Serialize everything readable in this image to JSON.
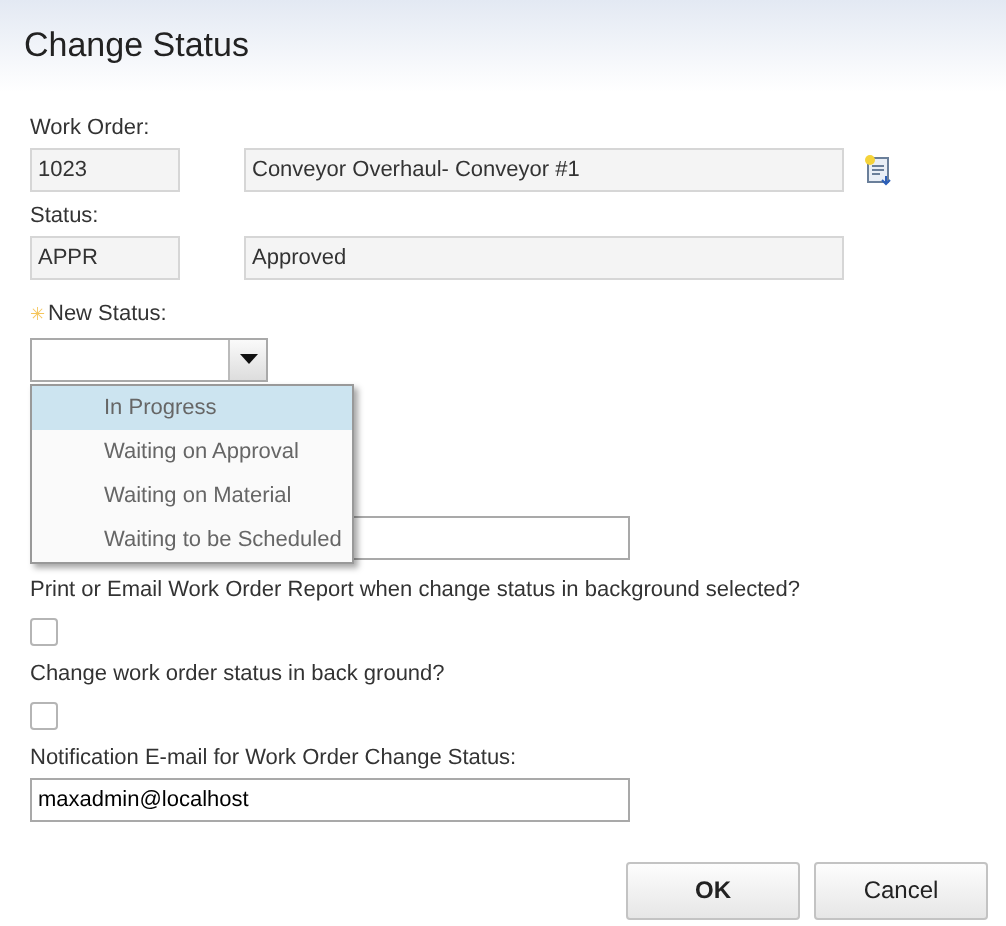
{
  "dialog": {
    "title": "Change Status"
  },
  "work_order": {
    "label": "Work Order:",
    "number": "1023",
    "description": "Conveyor Overhaul- Conveyor #1"
  },
  "status": {
    "label": "Status:",
    "code": "APPR",
    "description": "Approved"
  },
  "new_status": {
    "label": "New Status:",
    "required_mark": "✳",
    "expanded": true,
    "options": [
      {
        "label": "In Progress",
        "selected": true
      },
      {
        "label": "Waiting on Approval",
        "selected": false
      },
      {
        "label": "Waiting on Material",
        "selected": false
      },
      {
        "label": "Waiting to be Scheduled",
        "selected": false
      }
    ]
  },
  "print_report": {
    "label": "Print or Email Work Order Report when change status in background selected?",
    "checked": false
  },
  "background_change": {
    "label": "Change work order status in back ground?",
    "checked": false
  },
  "notification_email": {
    "label": "Notification E-mail for Work Order Change Status:",
    "value": "maxadmin@localhost"
  },
  "buttons": [
    "OK",
    "Cancel"
  ]
}
